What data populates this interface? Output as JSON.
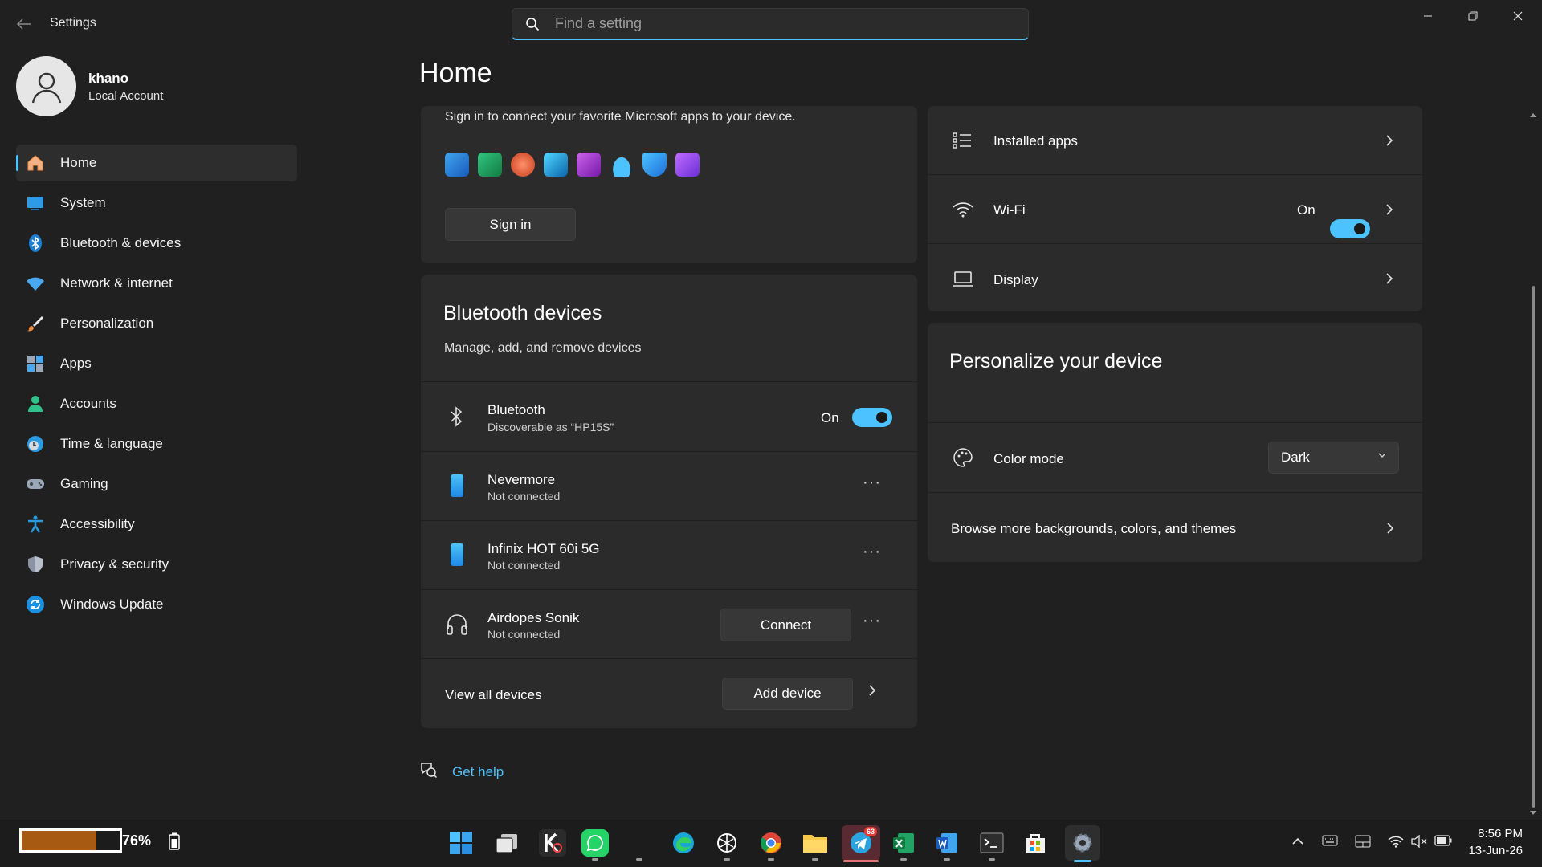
{
  "window": {
    "title": "Settings"
  },
  "search": {
    "placeholder": "Find a setting"
  },
  "profile": {
    "name": "khano",
    "account_type": "Local Account"
  },
  "sidebar": {
    "items": [
      {
        "label": "Home",
        "icon": "home-icon",
        "active": true
      },
      {
        "label": "System",
        "icon": "system-icon"
      },
      {
        "label": "Bluetooth & devices",
        "icon": "bluetooth-icon"
      },
      {
        "label": "Network & internet",
        "icon": "wifi-icon"
      },
      {
        "label": "Personalization",
        "icon": "brush-icon"
      },
      {
        "label": "Apps",
        "icon": "apps-icon"
      },
      {
        "label": "Accounts",
        "icon": "accounts-icon"
      },
      {
        "label": "Time & language",
        "icon": "clock-icon"
      },
      {
        "label": "Gaming",
        "icon": "gamepad-icon"
      },
      {
        "label": "Accessibility",
        "icon": "accessibility-icon"
      },
      {
        "label": "Privacy & security",
        "icon": "shield-icon"
      },
      {
        "label": "Windows Update",
        "icon": "update-icon"
      }
    ]
  },
  "main": {
    "page_title": "Home",
    "microsoft_account": {
      "text": "Sign in to connect your favorite Microsoft apps to your device.",
      "sign_in_label": "Sign in",
      "app_icons": [
        "word-icon",
        "excel-icon",
        "powerpoint-icon",
        "outlook-icon",
        "onenote-icon",
        "onedrive-icon",
        "defender-icon",
        "clipchamp-icon"
      ]
    },
    "bluetooth": {
      "title": "Bluetooth devices",
      "subtitle": "Manage, add, and remove devices",
      "bluetooth_row": {
        "title": "Bluetooth",
        "subtitle": "Discoverable as “HP15S”",
        "state": "On"
      },
      "devices": [
        {
          "name": "Nevermore",
          "status": "Not connected",
          "icon": "phone-icon"
        },
        {
          "name": "Infinix HOT 60i 5G",
          "status": "Not connected",
          "icon": "phone-icon"
        },
        {
          "name": "Airdopes Sonik",
          "status": "Not connected",
          "icon": "headphones-icon",
          "action": "Connect"
        }
      ],
      "view_all_label": "View all devices",
      "add_device_label": "Add device"
    },
    "quick_settings": [
      {
        "label": "Installed apps",
        "icon": "list-icon"
      },
      {
        "label": "Wi-Fi",
        "icon": "wifi-icon",
        "state": "On"
      },
      {
        "label": "Display",
        "icon": "monitor-icon"
      }
    ],
    "personalize": {
      "title": "Personalize your device",
      "color_mode_label": "Color mode",
      "color_mode_value": "Dark",
      "browse_label": "Browse more backgrounds, colors, and themes"
    },
    "get_help_label": "Get help"
  },
  "taskbar": {
    "battery_percent": "76%",
    "battery_level": 0.76,
    "telegram_badge": "63",
    "time": "8:56 PM",
    "date": "13-Jun-26"
  },
  "colors": {
    "accent": "#4cc2ff",
    "background": "#202020",
    "card": "#2b2b2b"
  }
}
